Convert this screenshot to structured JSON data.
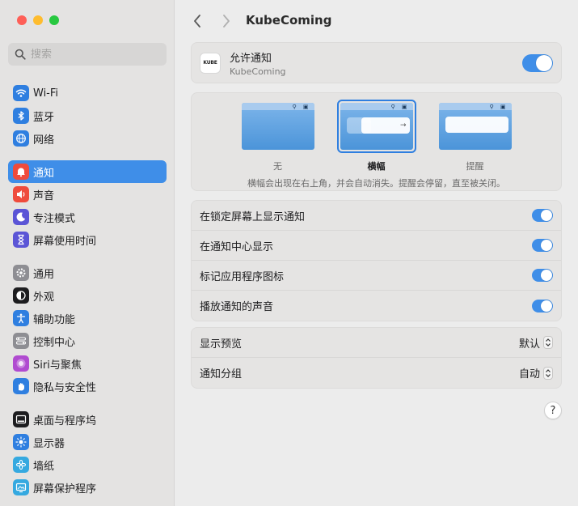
{
  "window": {
    "title": "KubeComing"
  },
  "sidebar": {
    "search_placeholder": "搜索",
    "groups": [
      [
        {
          "label": "Wi-Fi",
          "icon": "wifi-icon",
          "color": "#2f7fe0"
        },
        {
          "label": "蓝牙",
          "icon": "bluetooth-icon",
          "color": "#2f7fe0"
        },
        {
          "label": "网络",
          "icon": "globe-icon",
          "color": "#2f7fe0"
        }
      ],
      [
        {
          "label": "通知",
          "icon": "bell-icon",
          "color": "#ef4b3c",
          "active": true
        },
        {
          "label": "声音",
          "icon": "speaker-icon",
          "color": "#ef4b3c"
        },
        {
          "label": "专注模式",
          "icon": "moon-icon",
          "color": "#5b55d6"
        },
        {
          "label": "屏幕使用时间",
          "icon": "hourglass-icon",
          "color": "#5b55d6"
        }
      ],
      [
        {
          "label": "通用",
          "icon": "gear-icon",
          "color": "#8e8e93"
        },
        {
          "label": "外观",
          "icon": "appearance-icon",
          "color": "#1d1d1f"
        },
        {
          "label": "辅助功能",
          "icon": "accessibility-icon",
          "color": "#2f7fe0"
        },
        {
          "label": "控制中心",
          "icon": "control-center-icon",
          "color": "#8e8e93"
        },
        {
          "label": "Siri与聚焦",
          "icon": "siri-icon",
          "color": "#b04bd0"
        },
        {
          "label": "隐私与安全性",
          "icon": "hand-icon",
          "color": "#2f7fe0"
        }
      ],
      [
        {
          "label": "桌面与程序坞",
          "icon": "dock-icon",
          "color": "#1d1d1f"
        },
        {
          "label": "显示器",
          "icon": "sun-icon",
          "color": "#2f7fe0"
        },
        {
          "label": "墙纸",
          "icon": "flower-icon",
          "color": "#35a9e0"
        },
        {
          "label": "屏幕保护程序",
          "icon": "screensaver-icon",
          "color": "#35a9e0"
        }
      ]
    ]
  },
  "header": {
    "title": "KubeComing"
  },
  "app_card": {
    "icon_text": "KUBE",
    "label": "允许通知",
    "sublabel": "KubeComing",
    "allow": true
  },
  "styles": {
    "options": [
      {
        "label": "无",
        "selected": false
      },
      {
        "label": "横幅",
        "selected": true
      },
      {
        "label": "提醒",
        "selected": false
      }
    ],
    "description": "横幅会出现在右上角，并会自动消失。提醒会停留，直至被关闭。"
  },
  "toggles": [
    {
      "label": "在锁定屏幕上显示通知",
      "on": true
    },
    {
      "label": "在通知中心显示",
      "on": true
    },
    {
      "label": "标记应用程序图标",
      "on": true
    },
    {
      "label": "播放通知的声音",
      "on": true
    }
  ],
  "popups": [
    {
      "label": "显示预览",
      "value": "默认"
    },
    {
      "label": "通知分组",
      "value": "自动"
    }
  ],
  "help_label": "?"
}
